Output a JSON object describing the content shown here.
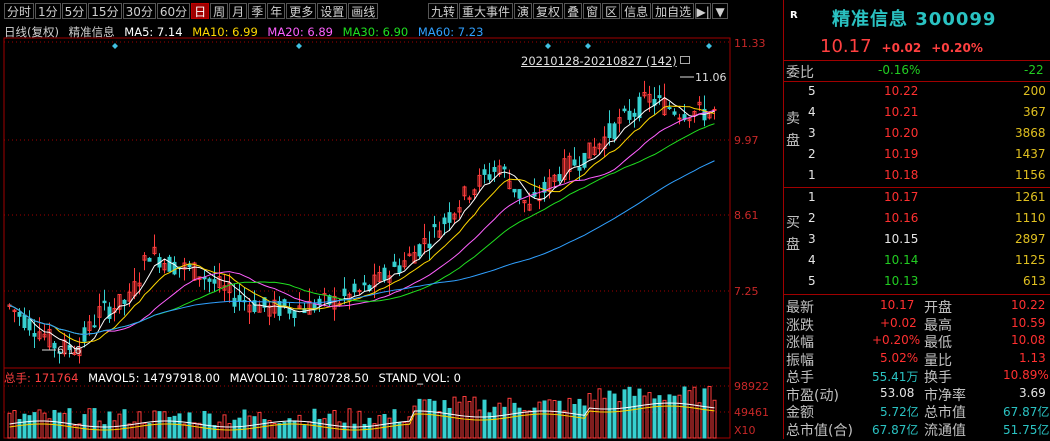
{
  "toolbar": {
    "periods": [
      "分时",
      "1分",
      "5分",
      "15分",
      "30分",
      "60分",
      "日",
      "周",
      "月",
      "季",
      "年",
      "更多",
      "设置",
      "画线"
    ],
    "active": "日",
    "extras": [
      "九转",
      "重大事件",
      "演",
      "复权",
      "叠",
      "窗",
      "区",
      "信息",
      "加自选"
    ],
    "icon_btn": "▶|",
    "dropdown": "▼"
  },
  "legend": {
    "title": "日线(复权)",
    "name": "精准信息",
    "ma5": "MA5: 7.14",
    "ma10": "MA10: 6.99",
    "ma20": "MA20: 6.89",
    "ma30": "MA30: 6.90",
    "ma60": "MA60: 7.23"
  },
  "range_label": "20210128-20210827 (142)",
  "annotations": {
    "high": "11.06",
    "low": "6.16"
  },
  "price_axis": [
    "11.33",
    "9.97",
    "8.61",
    "7.25"
  ],
  "vol_legend": {
    "total": "总手: 171764",
    "mavol5": "MAVOL5: 14797918.00",
    "mavol10": "MAVOL10: 11780728.50",
    "stand": "STAND_VOL: 0"
  },
  "vol_axis": [
    "98922",
    "49461",
    "X10"
  ],
  "colors": {
    "up": "#ff3c3c",
    "down": "#36d0d0",
    "ma5": "#ffffff",
    "ma10": "#ffd800",
    "ma20": "#ff60ff",
    "ma30": "#20e020",
    "ma60": "#30a0ff",
    "grid": "#a00000"
  },
  "chart_data": {
    "type": "candlestick",
    "range": "20210128-20210827",
    "count": 142,
    "ylim": [
      6.0,
      11.5
    ],
    "highest": 11.06,
    "lowest": 6.16
  },
  "quote": {
    "badge": "R",
    "name": "精准信息 300099",
    "price": "10.17",
    "change": "+0.02",
    "pct": "+0.20%",
    "weibi_label": "委比",
    "weibi_val": "-0.16%",
    "weibi_diff": "-22",
    "sell_label": [
      "卖",
      "盘"
    ],
    "buy_label": [
      "买",
      "盘"
    ],
    "asks": [
      {
        "lvl": "5",
        "price": "10.22",
        "vol": "200"
      },
      {
        "lvl": "4",
        "price": "10.21",
        "vol": "367"
      },
      {
        "lvl": "3",
        "price": "10.20",
        "vol": "3868"
      },
      {
        "lvl": "2",
        "price": "10.19",
        "vol": "1437"
      },
      {
        "lvl": "1",
        "price": "10.18",
        "vol": "1156"
      }
    ],
    "bids": [
      {
        "lvl": "1",
        "price": "10.17",
        "vol": "1261"
      },
      {
        "lvl": "2",
        "price": "10.16",
        "vol": "1110"
      },
      {
        "lvl": "3",
        "price": "10.15",
        "vol": "2897"
      },
      {
        "lvl": "4",
        "price": "10.14",
        "vol": "1125"
      },
      {
        "lvl": "5",
        "price": "10.13",
        "vol": "613"
      }
    ],
    "stats": [
      {
        "l": "最新",
        "v": "10.17",
        "l2": "开盘",
        "v2": "10.22"
      },
      {
        "l": "涨跌",
        "v": "+0.02",
        "l2": "最高",
        "v2": "10.59"
      },
      {
        "l": "涨幅",
        "v": "+0.20%",
        "l2": "最低",
        "v2": "10.08"
      },
      {
        "l": "振幅",
        "v": "5.02%",
        "l2": "量比",
        "v2": "1.13"
      },
      {
        "l": "总手",
        "v": "55.41万",
        "l2": "换手",
        "v2": "10.89%"
      },
      {
        "l": "市盈(动)",
        "v": "53.08",
        "l2": "市净率",
        "v2": "3.69"
      },
      {
        "l": "金额",
        "v": "5.72亿",
        "l2": "总市值",
        "v2": "67.87亿"
      },
      {
        "l": "总市值(合)",
        "v": "67.87亿",
        "l2": "流通值",
        "v2": "51.75亿"
      }
    ]
  }
}
